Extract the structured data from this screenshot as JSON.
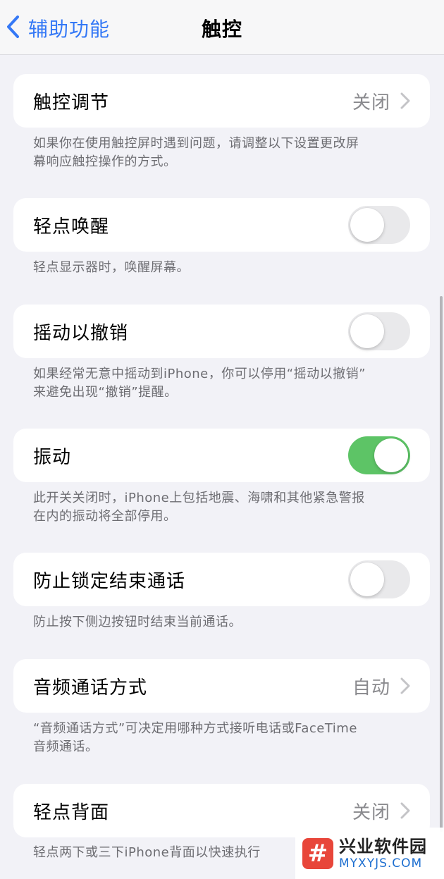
{
  "nav": {
    "back_label": "辅助功能",
    "title": "触控"
  },
  "rows": {
    "touch_accommodations": {
      "label": "触控调节",
      "value": "关闭"
    },
    "tap_to_wake": {
      "label": "轻点唤醒",
      "on": false
    },
    "shake_to_undo": {
      "label": "摇动以撤销",
      "on": false
    },
    "vibration": {
      "label": "振动",
      "on": true
    },
    "prevent_lock_end_call": {
      "label": "防止锁定结束通话",
      "on": false
    },
    "call_audio_routing": {
      "label": "音频通话方式",
      "value": "自动"
    },
    "back_tap": {
      "label": "轻点背面",
      "value": "关闭"
    }
  },
  "footers": {
    "touch_accommodations": [
      "如果你在使用触控屏时遇到问题，请调整以下设置更改屏",
      "幕响应触控操作的方式。"
    ],
    "tap_to_wake": [
      "轻点显示器时，唤醒屏幕。"
    ],
    "shake_to_undo": [
      "如果经常无意中摇动到iPhone，你可以停用“摇动以撤销”",
      "来避免出现“撤销”提醒。"
    ],
    "vibration": [
      "此开关关闭时，iPhone上包括地震、海啸和其他紧急警报",
      "在内的振动将全部停用。"
    ],
    "prevent_lock_end_call": [
      "防止按下侧边按钮时结束当前通话。"
    ],
    "call_audio_routing": [
      "“音频通话方式”可决定用哪种方式接听电话或FaceTime",
      "音频通话。"
    ],
    "back_tap": [
      "轻点两下或三下iPhone背面以快速执行"
    ]
  },
  "watermark": {
    "logo_glyph": "#",
    "name": "兴业软件园",
    "url": "MYXYJS.COM"
  },
  "colors": {
    "accent": "#3478f6",
    "toggle_on": "#5dc466",
    "toggle_off": "#e9e9eb",
    "background": "#f2f2f7"
  }
}
